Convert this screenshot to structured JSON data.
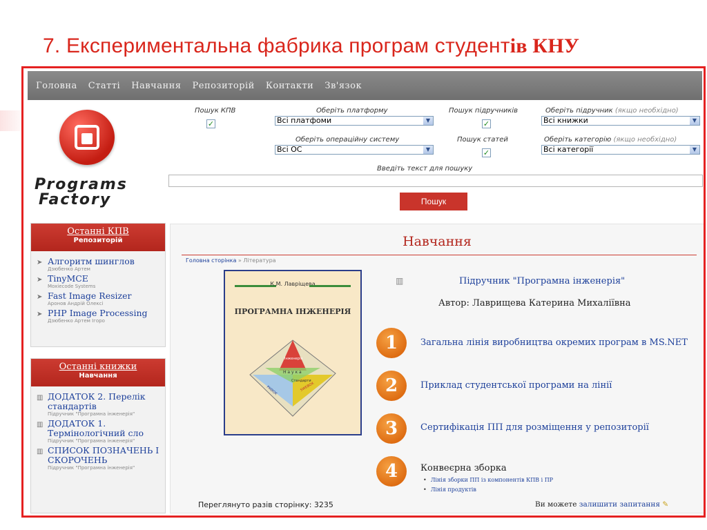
{
  "slide_title": {
    "main": "7. Експериментальна фабрика програм студент",
    "serif_tail": "ів КНУ"
  },
  "nav": [
    "Головна",
    "Статті",
    "Навчання",
    "Репозиторій",
    "Контакти",
    "Зв'язок"
  ],
  "logo": {
    "line1": "Programs",
    "line2": "Factory"
  },
  "filters": {
    "kpv_label": "Пошук КПВ",
    "platform_label": "Оберіть платформу",
    "platform_value": "Всі платфоми",
    "textbook_search_label": "Пошук підручників",
    "textbook_label": "Оберіть підручник",
    "textbook_optional": "(якщо необхідно)",
    "textbook_value": "Всі книжки",
    "os_label": "Оберіть операційну систему",
    "os_value": "Всі ОС",
    "articles_label": "Пошук статей",
    "category_label": "Оберіть категорію",
    "category_optional": "(якщо необхідно)",
    "category_value": "Всі категорії",
    "search_text_label": "Введіть текст для пошуку",
    "search_value": "",
    "search_button": "Пошук",
    "checkmark": "✓"
  },
  "sidebar_kpv": {
    "title": "Останні КПВ",
    "subtitle": "Репозиторій",
    "items": [
      {
        "title": "Алгоритм шинглов",
        "sub": "Дзюбенко Артем"
      },
      {
        "title": "TinyMCE",
        "sub": "Moxiecode Systems"
      },
      {
        "title": "Fast Image Resizer",
        "sub": "Аронов Андрій Олексі"
      },
      {
        "title": "PHP Image Processing",
        "sub": "Дзюбенко Артем Ігоро"
      }
    ]
  },
  "sidebar_books": {
    "title": "Останні книжки",
    "subtitle": "Навчання",
    "items": [
      {
        "title": "ДОДАТОК 2. Перелік стандартів",
        "sub": "Підручник \"Програмна інженерія\""
      },
      {
        "title": "ДОДАТОК 1. Термінологічний сло",
        "sub": "Підручник \"Програмна інженерія\""
      },
      {
        "title": "СПИСОК ПОЗНАЧЕНЬ І СКОРОЧЕНЬ",
        "sub": "Підручник \"Програмна інженерія\""
      }
    ]
  },
  "main": {
    "title": "Навчання",
    "breadcrumb_link": "Головна сторінка",
    "breadcrumb_rest": " » Література",
    "book_cover_author": "К.М. Лавріщева",
    "book_cover_title": "ПРОГРАМНА ІНЖЕНЕРІЯ",
    "book_cover_inner_1": "Інженерія",
    "book_cover_inner_2": "Н а у к а",
    "book_cover_inner_3": "Стандарти",
    "book_cover_inner_4": "SWEBOK",
    "book_cover_inner_5": "PMBOK",
    "textbook_title": "Підручник \"Програмна інженерія\"",
    "author_line": "Автор: Лаврищева Катерина Михаліївна",
    "steps": [
      {
        "num": "1",
        "text": "Загальна лінія виробництва окремих програм в MS.NET"
      },
      {
        "num": "2",
        "text": "Приклад студентської програми на лінії"
      },
      {
        "num": "3",
        "text": "Сертифікація ПП для розміщення у репозиторії"
      },
      {
        "num": "4",
        "text": "Конвеєрна зборка"
      }
    ],
    "bullets": [
      "Лінія зборки ПП із компонентів КПВ і ПР",
      "Лінія продуктів"
    ],
    "views": "Переглянуто разів сторінку: 3235",
    "ask_prefix": "Ви можете ",
    "ask_link": "залишити запитання",
    "ask_icon": "✎"
  }
}
